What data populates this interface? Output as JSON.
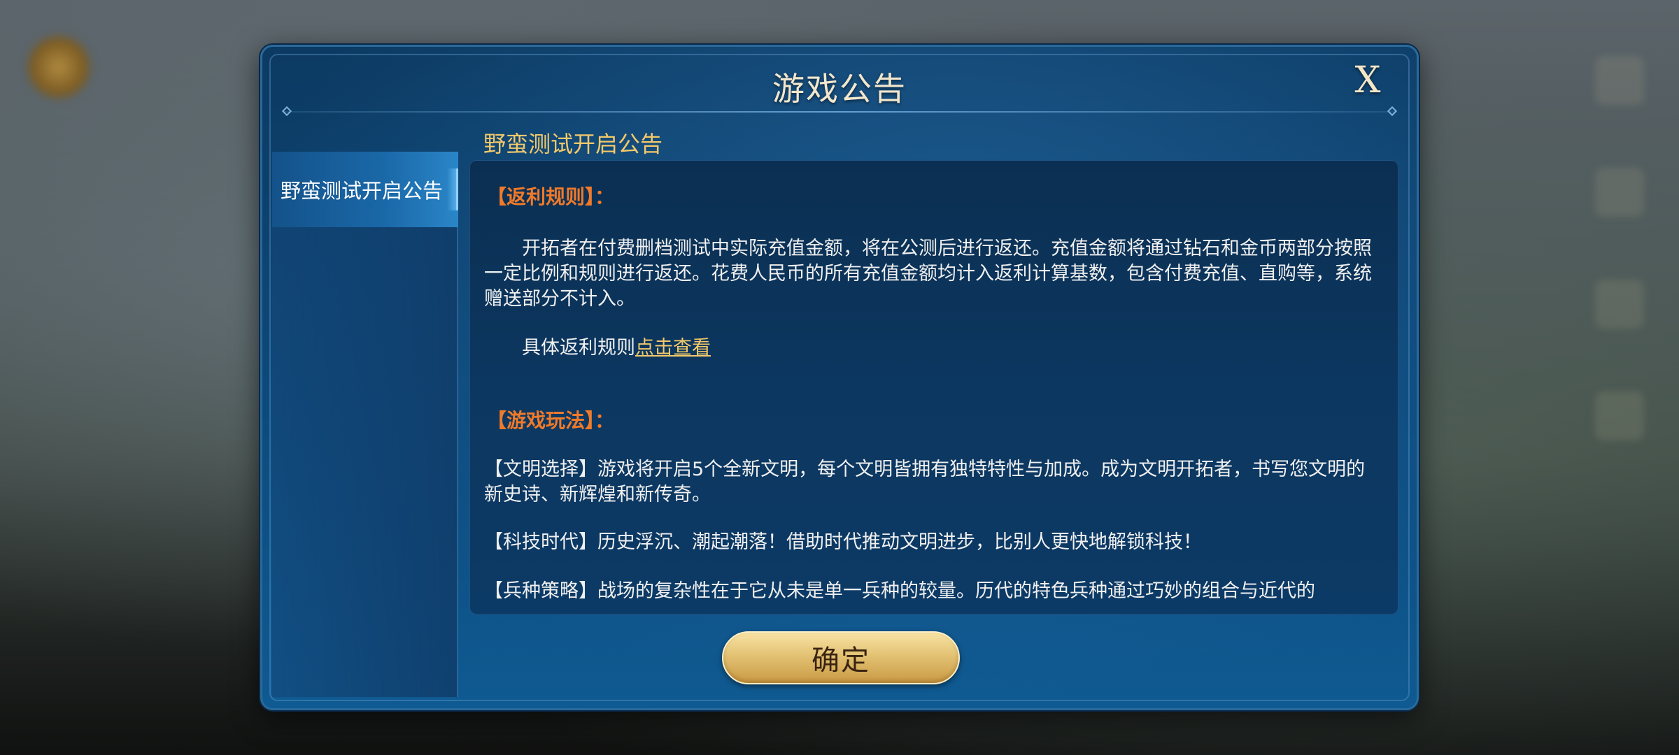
{
  "dialog": {
    "title": "游戏公告",
    "close_label": "X",
    "confirm_label": "确定"
  },
  "sidebar": {
    "items": [
      {
        "label": "野蛮测试开启公告",
        "selected": true
      }
    ]
  },
  "content": {
    "title": "野蛮测试开启公告",
    "section1_heading": "【返利规则】：",
    "section1_para": "开拓者在付费删档测试中实际充值金额，将在公测后进行返还。充值金额将通过钻石和金币两部分按照一定比例和规则进行返还。花费人民币的所有充值金额均计入返利计算基数，包含付费充值、直购等，系统赠送部分不计入。",
    "rule_prefix": "具体返利规则",
    "rule_link": "点击查看",
    "section2_heading": "【游戏玩法】：",
    "gameplay": [
      "【文明选择】游戏将开启5个全新文明，每个文明皆拥有独特特性与加成。成为文明开拓者，书写您文明的新史诗、新辉煌和新传奇。",
      "【科技时代】历史浮沉、潮起潮落！借助时代推动文明进步，比别人更快地解锁科技！",
      "【兵种策略】战场的复杂性在于它从未是单一兵种的较量。历代的特色兵种通过巧妙的组合与近代的"
    ]
  },
  "colors": {
    "heading_orange": "#f07a2a",
    "gold": "#f3c96a",
    "panel_blue": "#0c3760"
  }
}
